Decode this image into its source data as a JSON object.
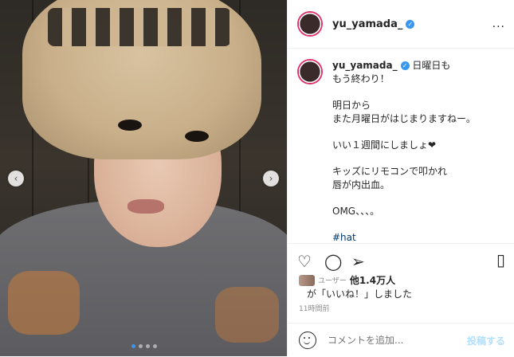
{
  "post": {
    "username": "yu_yamada_",
    "more_label": "...",
    "caption_lines": [
      "日曜日も",
      "もう終わり！",
      "",
      "明日から",
      "また月曜日がはじまりますねー。",
      "",
      "いい１週間にしましょ❤",
      "",
      "キッズにリモコンで叩かれ",
      "唇が内出血。",
      "",
      "OMG、、、。",
      "",
      "#hat"
    ],
    "likes_avatar_text": "ユーザー",
    "likes_count_text": "他1.4万人",
    "likes_suffix": "が「いいね！」しました",
    "timestamp": "11時間前",
    "comment_placeholder": "コメントを追加...",
    "post_button": "投稿する"
  },
  "carousel": {
    "prev_label": "‹",
    "next_label": "›",
    "slide_count": 4,
    "active_index": 0
  },
  "colors": {
    "accent": "#3897f0",
    "post_button": "#b2dffc"
  },
  "icons": [
    "verified-icon",
    "more-icon",
    "heart-icon",
    "comment-icon",
    "share-icon",
    "bookmark-icon",
    "emoji-icon",
    "chevron-left-icon",
    "chevron-right-icon"
  ]
}
